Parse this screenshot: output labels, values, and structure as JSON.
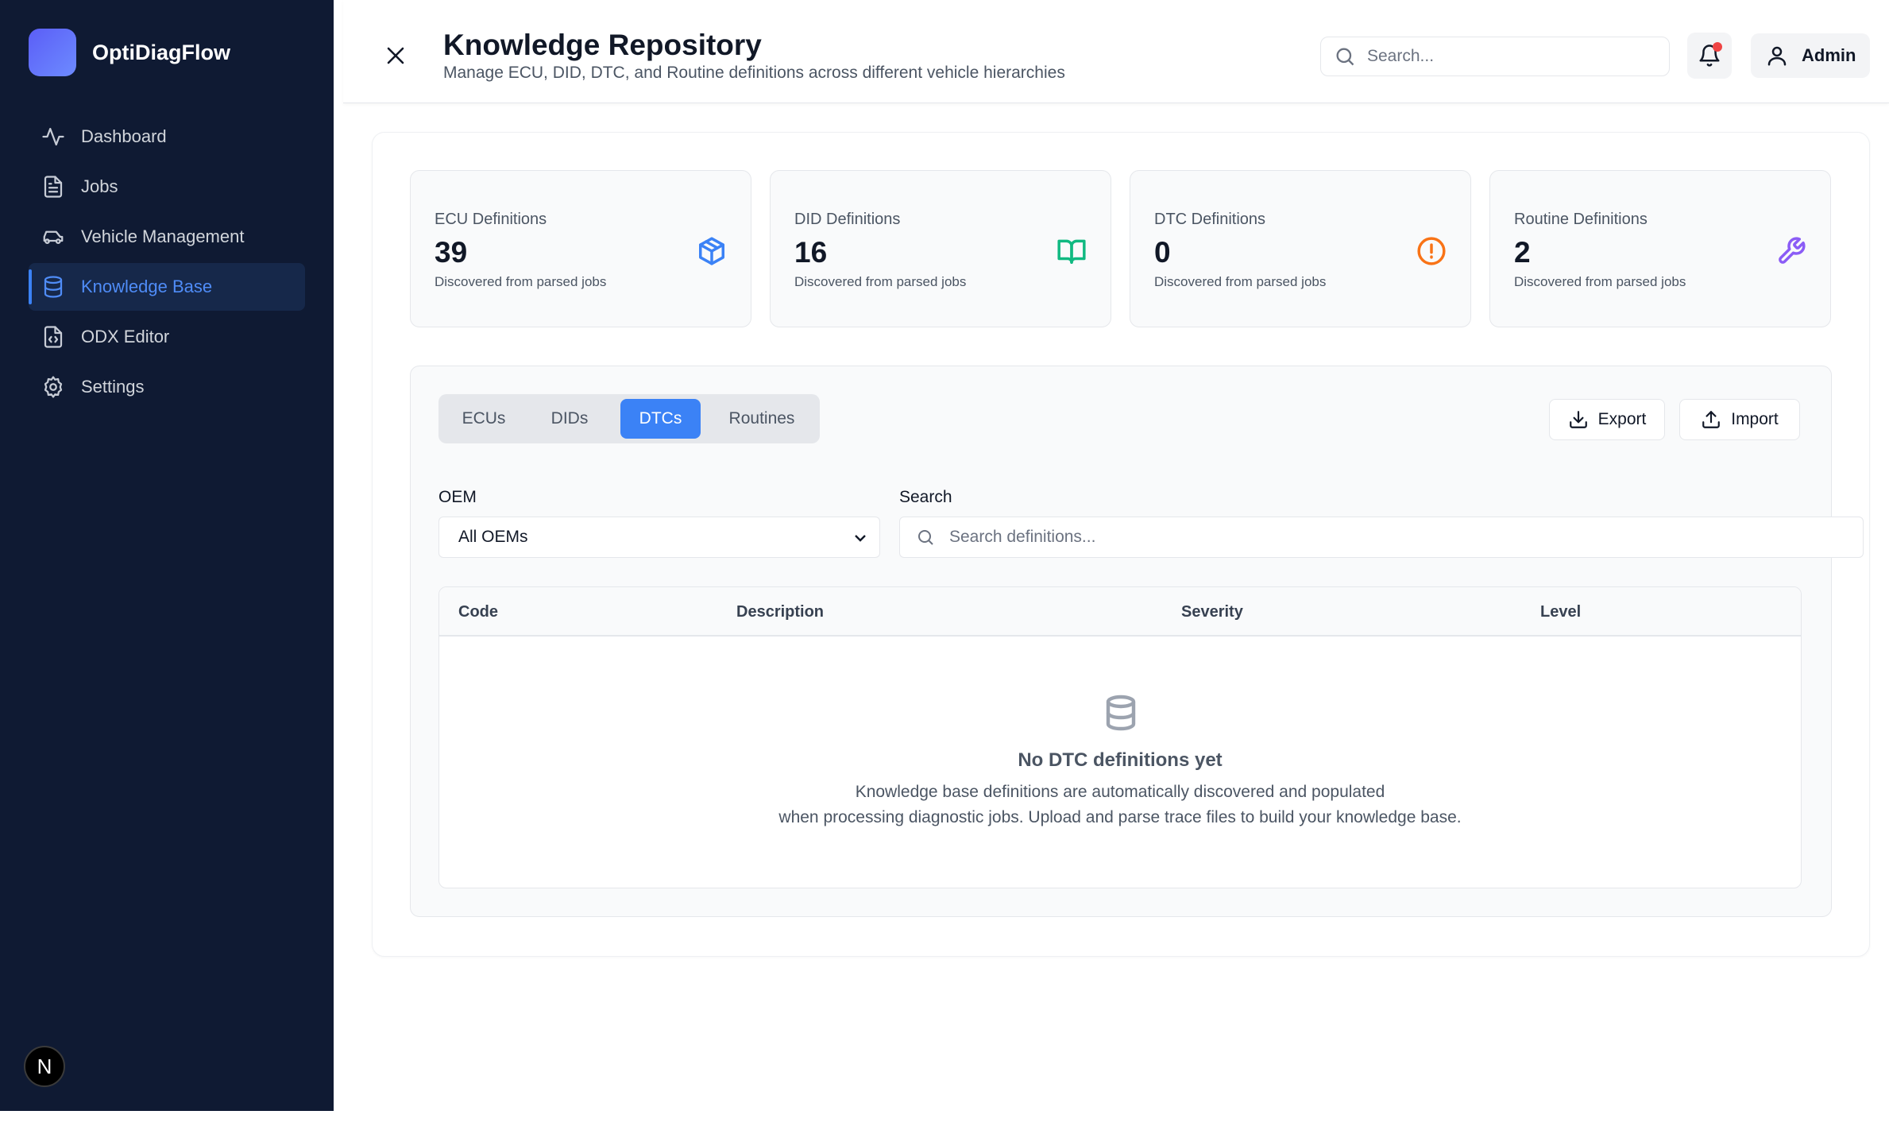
{
  "app": {
    "name": "OptiDiagFlow",
    "badge_letter": "N"
  },
  "sidebar": {
    "items": [
      {
        "label": "Dashboard",
        "icon": "activity-icon"
      },
      {
        "label": "Jobs",
        "icon": "file-text-icon"
      },
      {
        "label": "Vehicle Management",
        "icon": "car-icon"
      },
      {
        "label": "Knowledge Base",
        "icon": "database-icon",
        "active": true
      },
      {
        "label": "ODX Editor",
        "icon": "file-code-icon"
      },
      {
        "label": "Settings",
        "icon": "gear-icon"
      }
    ]
  },
  "header": {
    "title": "Knowledge Repository",
    "subtitle": "Manage ECU, DID, DTC, and Routine definitions across different vehicle hierarchies",
    "search_placeholder": "Search...",
    "user_label": "Admin"
  },
  "stats": [
    {
      "label": "ECU Definitions",
      "value": "39",
      "desc": "Discovered from parsed jobs",
      "icon": "box-icon",
      "color": "#3b82f6"
    },
    {
      "label": "DID Definitions",
      "value": "16",
      "desc": "Discovered from parsed jobs",
      "icon": "book-open-icon",
      "color": "#10b981"
    },
    {
      "label": "DTC Definitions",
      "value": "0",
      "desc": "Discovered from parsed jobs",
      "icon": "alert-circle-icon",
      "color": "#f97316"
    },
    {
      "label": "Routine Definitions",
      "value": "2",
      "desc": "Discovered from parsed jobs",
      "icon": "wrench-icon",
      "color": "#8b5cf6"
    }
  ],
  "tabs": [
    {
      "label": "ECUs"
    },
    {
      "label": "DIDs"
    },
    {
      "label": "DTCs",
      "active": true
    },
    {
      "label": "Routines"
    }
  ],
  "actions": {
    "export_label": "Export",
    "import_label": "Import"
  },
  "filters": {
    "oem_label": "OEM",
    "oem_selected": "All OEMs",
    "search_label": "Search",
    "search_placeholder": "Search definitions..."
  },
  "table": {
    "columns": [
      "Code",
      "Description",
      "Severity",
      "Level"
    ],
    "empty_title": "No DTC definitions yet",
    "empty_line1": "Knowledge base definitions are automatically discovered and populated",
    "empty_line2": "when processing diagnostic jobs. Upload and parse trace files to build your knowledge base."
  }
}
